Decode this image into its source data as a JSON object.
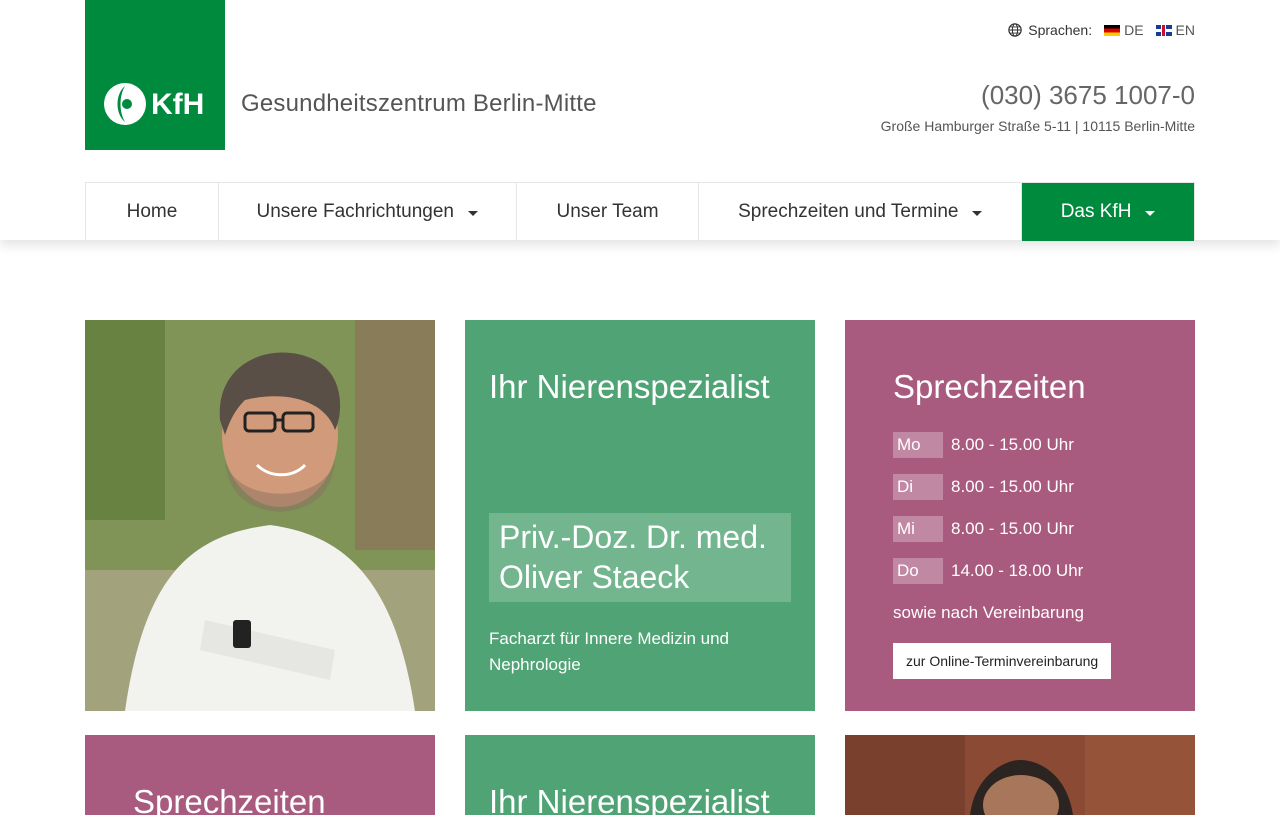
{
  "header": {
    "site_title": "Gesundheitszentrum Berlin-Mitte",
    "logo_text": "KfH",
    "lang_label": "Sprachen:",
    "languages": [
      {
        "code": "DE"
      },
      {
        "code": "EN"
      }
    ],
    "phone": "(030) 3675 1007-0",
    "address": "Große Hamburger Straße 5-11 | 10115 Berlin-Mitte"
  },
  "nav": {
    "items": [
      {
        "label": "Home"
      },
      {
        "label": "Unsere Fachrichtungen"
      },
      {
        "label": "Unser Team"
      },
      {
        "label": "Sprechzeiten und Termine"
      },
      {
        "label": "Das KfH"
      }
    ]
  },
  "tiles": {
    "specialist": {
      "heading": "Ihr Nierenspezialist",
      "doctor_name": "Priv.-Doz. Dr. med. Oliver Staeck",
      "specialty": "Facharzt für Innere Medizin und Nephrologie"
    },
    "hours": {
      "heading": "Sprechzeiten",
      "rows": [
        {
          "day": "Mo",
          "time": "8.00 - 15.00 Uhr"
        },
        {
          "day": "Di",
          "time": "8.00 - 15.00 Uhr"
        },
        {
          "day": "Mi",
          "time": "8.00 - 15.00 Uhr"
        },
        {
          "day": "Do",
          "time": "14.00 - 18.00 Uhr"
        }
      ],
      "note": "sowie nach Vereinbarung",
      "button_label": "zur Online-Terminvereinbarung"
    },
    "row2": {
      "hours_heading": "Sprechzeiten",
      "specialist_heading": "Ihr Nierenspezialist"
    }
  },
  "colors": {
    "brand_green": "#008a3e",
    "tile_green": "#4fa374",
    "tile_purple": "#a85b7e"
  }
}
